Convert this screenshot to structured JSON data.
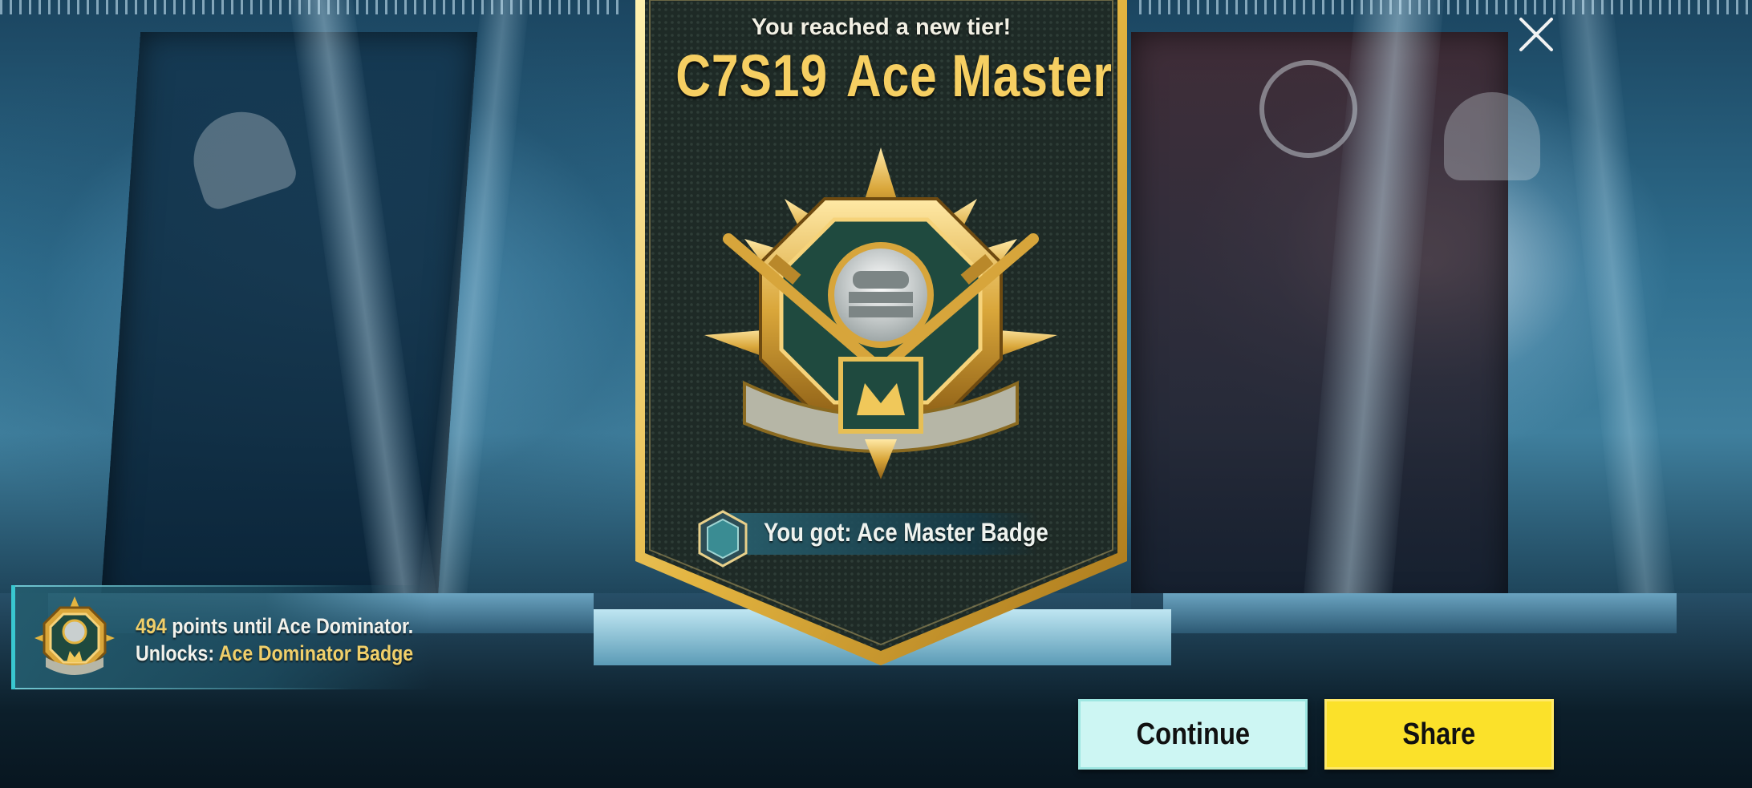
{
  "header": {
    "message": "You reached a new tier!",
    "season": "C7S19",
    "tier": "Ace Master"
  },
  "reward": {
    "text": "You got: Ace Master Badge"
  },
  "progress": {
    "points": "494",
    "points_suffix": " points until Ace Dominator.",
    "unlocks_prefix": "Unlocks: ",
    "unlocks_item": "Ace Dominator Badge"
  },
  "buttons": {
    "continue_label": "Continue",
    "share_label": "Share"
  },
  "icons": {
    "close": "close-icon",
    "tier_emblem": "ace-master-emblem",
    "reward": "badge-hexagon-icon",
    "next_tier": "ace-dominator-emblem"
  },
  "colors": {
    "gold": "#f6cf62",
    "continue_bg": "#cdf6f3",
    "share_bg": "#fbe12a",
    "panel_accent": "#39c7d0"
  }
}
